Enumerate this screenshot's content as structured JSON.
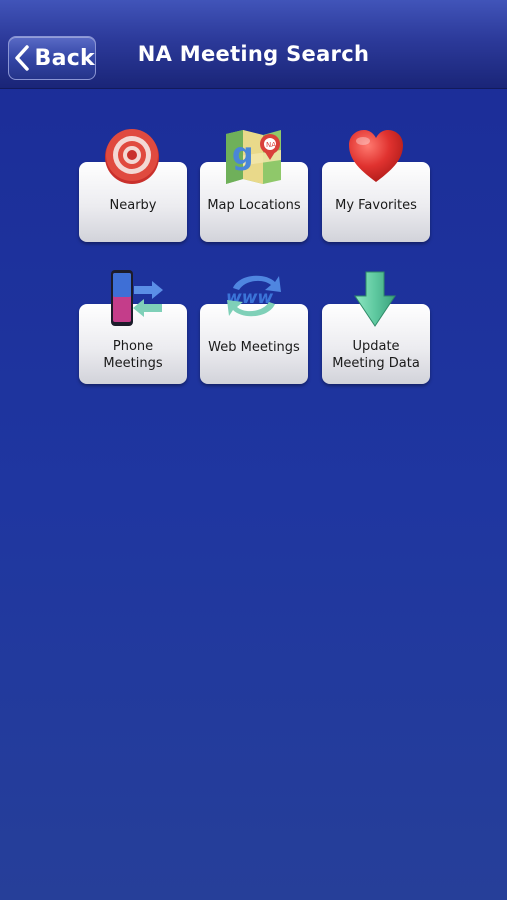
{
  "nav": {
    "back_label": "Back",
    "title": "NA Meeting Search"
  },
  "tiles": [
    {
      "label": "Nearby",
      "icon": "target-icon"
    },
    {
      "label": "Map Locations",
      "icon": "map-icon"
    },
    {
      "label": "My Favorites",
      "icon": "heart-icon"
    },
    {
      "label_line1": "Phone",
      "label_line2": "Meetings",
      "icon": "phone-icon"
    },
    {
      "label": "Web Meetings",
      "icon": "www-icon"
    },
    {
      "label_line1": "Update",
      "label_line2": "Meeting Data",
      "icon": "download-arrow-icon"
    }
  ],
  "colors": {
    "background": "#1f36a0",
    "nav_bar": "#2c3a9a",
    "tile": "#ececf0",
    "heart": "#e0322f",
    "target": "#c9302c",
    "download_arrow": "#5fc9a0"
  }
}
